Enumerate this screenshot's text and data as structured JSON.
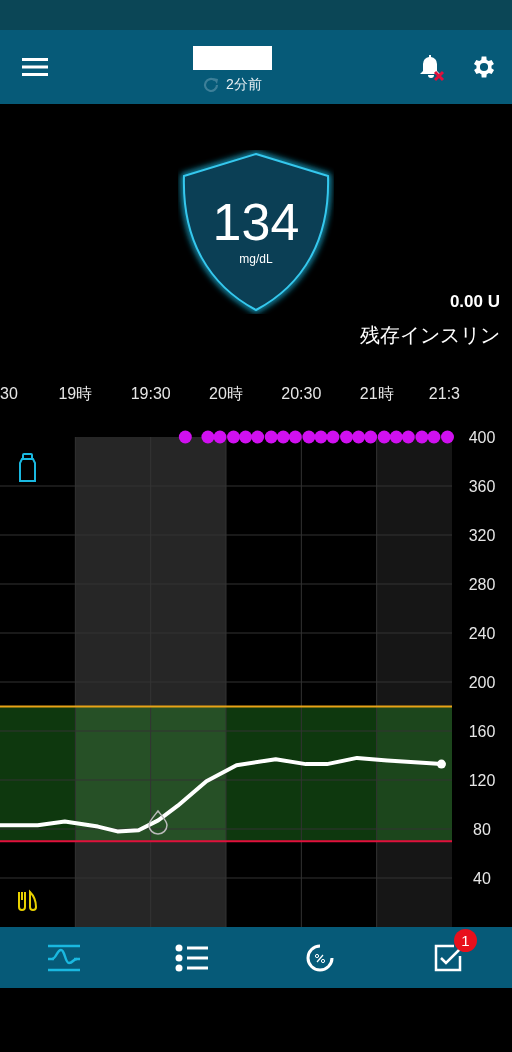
{
  "header": {
    "updated": "2分前"
  },
  "reading": {
    "value": "134",
    "unit": "mg/dL"
  },
  "insulin": {
    "amount": "0.00 U",
    "label": "残存インスリン"
  },
  "chart": {
    "chart_data": {
      "type": "line",
      "x": [
        18.5,
        18.75,
        18.93,
        19.15,
        19.28,
        19.42,
        19.55,
        19.68,
        19.87,
        20.07,
        20.33,
        20.53,
        20.67,
        20.87,
        21.07,
        21.33,
        21.43
      ],
      "series": [
        {
          "color": "#ffffff",
          "values": [
            83,
            83,
            86,
            82,
            78,
            79,
            87,
            99,
            119,
            132,
            137,
            133,
            133,
            138,
            136,
            134,
            133
          ]
        },
        {
          "type": "scatter",
          "color": "#d010f0",
          "x": [
            19.73,
            19.88,
            19.96,
            20.05,
            20.13,
            20.21,
            20.3,
            20.38,
            20.46,
            20.55,
            20.63,
            20.71,
            20.8,
            20.88,
            20.96,
            21.05,
            21.13,
            21.21,
            21.3,
            21.38,
            21.47
          ],
          "values": [
            400,
            400,
            400,
            400,
            400,
            400,
            400,
            400,
            400,
            400,
            400,
            400,
            400,
            400,
            400,
            400,
            400,
            400,
            400,
            400,
            400
          ]
        }
      ],
      "xlim": [
        18.5,
        21.5
      ],
      "ylim": [
        0,
        400
      ],
      "xticks": [
        {
          "label": "30"
        },
        {
          "value": 19,
          "label": "19時"
        },
        {
          "value": 19.5,
          "label": "19:30"
        },
        {
          "value": 20,
          "label": "20時"
        },
        {
          "value": 20.5,
          "label": "20:30"
        },
        {
          "value": 21,
          "label": "21時"
        },
        {
          "value": 21.5,
          "label": "21:3"
        }
      ],
      "yticks": [
        40,
        80,
        120,
        160,
        200,
        240,
        280,
        320,
        360,
        400
      ],
      "grid": true,
      "bands": [
        {
          "axis": "x",
          "from": 19,
          "to": 20,
          "color": "#262626"
        },
        {
          "axis": "x",
          "from": 21,
          "to": 21.5,
          "color": "#161616"
        },
        {
          "axis": "y",
          "from": 70,
          "to": 180,
          "color": "#28a028"
        }
      ],
      "ref_lines": [
        {
          "axis": "y",
          "value": 180,
          "color": "#e8a317"
        },
        {
          "axis": "y",
          "value": 70,
          "color": "#e0103c"
        }
      ]
    }
  },
  "nav": [
    {
      "kind": "graph",
      "selected": true
    },
    {
      "kind": "list",
      "selected": false
    },
    {
      "kind": "percent",
      "selected": false
    },
    {
      "kind": "checklist",
      "selected": false,
      "badge": "1"
    }
  ]
}
